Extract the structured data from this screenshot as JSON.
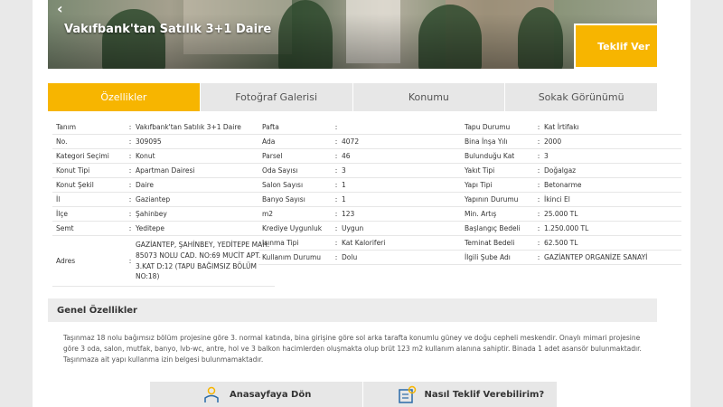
{
  "hero": {
    "title": "Vakıfbank'tan Satılık 3+1 Daire",
    "offer_button": "Teklif Ver",
    "back_arrow": "‹"
  },
  "tabs": [
    {
      "label": "Özellikler",
      "active": true
    },
    {
      "label": "Fotoğraf Galerisi",
      "active": false
    },
    {
      "label": "Konumu",
      "active": false
    },
    {
      "label": "Sokak Görünümü",
      "active": false
    }
  ],
  "details_col1": [
    {
      "key": "Tanım",
      "value": "Vakıfbank'tan Satılık 3+1 Daire"
    },
    {
      "key": "No.",
      "value": "309095"
    },
    {
      "key": "Kategori Seçimi",
      "value": "Konut"
    },
    {
      "key": "Konut Tipi",
      "value": "Apartman Dairesi"
    },
    {
      "key": "Konut Şekil",
      "value": "Daire"
    },
    {
      "key": "İl",
      "value": "Gaziantep"
    },
    {
      "key": "İlçe",
      "value": "Şahinbey"
    },
    {
      "key": "Semt",
      "value": "Yeditepe"
    },
    {
      "key": "Adres",
      "value": "GAZİANTEP, ŞAHİNBEY, YEDİTEPE MAH. 85073 NOLU CAD. NO:69 MUCİT APT. 3.KAT D:12 (TAPU BAĞIMSIZ BÖLÜM NO:18)"
    }
  ],
  "details_col2": [
    {
      "key": "Pafta",
      "value": ""
    },
    {
      "key": "Ada",
      "value": "4072"
    },
    {
      "key": "Parsel",
      "value": "46"
    },
    {
      "key": "Oda Sayısı",
      "value": "3"
    },
    {
      "key": "Salon Sayısı",
      "value": "1"
    },
    {
      "key": "Banyo Sayısı",
      "value": "1"
    },
    {
      "key": "m2",
      "value": "123"
    },
    {
      "key": "Krediye Uygunluk",
      "value": "Uygun"
    },
    {
      "key": "Isınma Tipi",
      "value": "Kat Kaloriferi"
    },
    {
      "key": "Kullanım Durumu",
      "value": "Dolu"
    }
  ],
  "details_col3": [
    {
      "key": "Tapu Durumu",
      "value": "Kat İrtifakı"
    },
    {
      "key": "Bina İnşa Yılı",
      "value": "2000"
    },
    {
      "key": "Bulunduğu Kat",
      "value": "3"
    },
    {
      "key": "Yakıt Tipi",
      "value": "Doğalgaz"
    },
    {
      "key": "Yapı Tipi",
      "value": "Betonarme"
    },
    {
      "key": "Yapının Durumu",
      "value": "İkinci El"
    },
    {
      "key": "Min. Artış",
      "value": "25.000 TL"
    },
    {
      "key": "Başlangıç Bedeli",
      "value": "1.250.000 TL"
    },
    {
      "key": "Teminat Bedeli",
      "value": "62.500 TL"
    },
    {
      "key": "İlgili Şube Adı",
      "value": "GAZİANTEP ORGANİZE SANAYİ"
    }
  ],
  "general": {
    "heading": "Genel Özellikler",
    "text": "Taşınmaz 18 nolu bağımsız bölüm projesine göre 3. normal katında, bina girişine göre sol arka tarafta konumlu güney ve doğu cepheli meskendir. Onaylı mimari projesine göre 3 oda, salon, mutfak, banyo, lvb-wc, antre, hol ve 3 balkon hacimlerden oluşmakta olup brüt 123 m2 kullanım alanına sahiptir. Binada 1 adet asansör bulunmaktadır. Taşınmaza ait yapı kullanma izin belgesi bulunmamaktadır."
  },
  "bottom": {
    "home_label": "Anasayfaya Dön",
    "howto_label": "Nasıl Teklif Verebilirim?"
  },
  "colors": {
    "accent": "#f7b500",
    "tab_bg": "#e7e7e7",
    "page_bg": "#e9e9e9"
  }
}
